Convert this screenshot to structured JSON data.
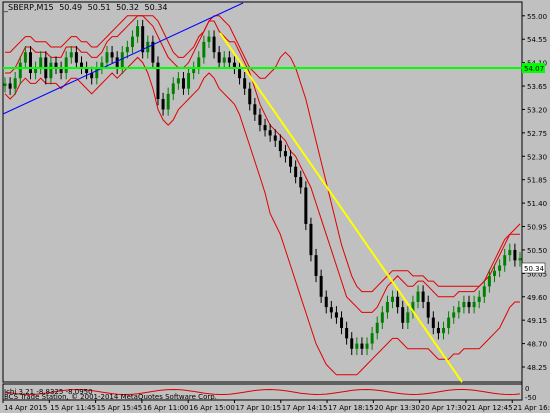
{
  "window": {
    "symbol": "_SBERP,M15",
    "ohlc": [
      "50.49",
      "50.51",
      "50.32",
      "50.34"
    ]
  },
  "indicator": {
    "label": "Ichi 3.21 -8.8325 -8.0950"
  },
  "copyright": "BCS Trade Station, © 2001-2014 MetaQuotes Software Corp.",
  "colors": {
    "background": "#c0c0c0",
    "bull": "#008000",
    "bear": "#000000",
    "bands": "#e00000",
    "trendline": "#ffff00",
    "channel": "#0000ff",
    "hline": "#00ff00"
  },
  "chart_data": {
    "type": "candlestick",
    "y_ticks": [
      "55.00",
      "54.55",
      "54.10",
      "53.65",
      "53.20",
      "52.75",
      "52.30",
      "51.85",
      "51.40",
      "50.95",
      "50.50",
      "50.05",
      "49.60",
      "49.15",
      "48.70",
      "48.25"
    ],
    "ylim": [
      48.0,
      55.15
    ],
    "x_ticks": [
      "14 Apr 2015",
      "15 Apr 11:45",
      "15 Apr 15:45",
      "16 Apr 11:00",
      "16 Apr 15:00",
      "17 Apr 10:15",
      "17 Apr 14:15",
      "17 Apr 18:15",
      "20 Apr 13:30",
      "20 Apr 17:30",
      "21 Apr 12:45",
      "21 Apr 16:45"
    ],
    "horizontal_line": {
      "value": 54.07,
      "label": "54.07"
    },
    "price_badge": {
      "value": 50.34,
      "label": "50.34"
    },
    "indicator_ticks": [
      "0",
      "-50"
    ],
    "closes": [
      53.7,
      53.6,
      53.8,
      54.1,
      54.3,
      53.9,
      54.0,
      54.2,
      53.8,
      54.1,
      54.0,
      53.9,
      54.2,
      54.3,
      54.1,
      54.0,
      53.9,
      53.8,
      54.0,
      54.1,
      54.3,
      54.2,
      54.0,
      54.3,
      54.4,
      54.6,
      54.8,
      54.3,
      54.5,
      54.1,
      53.4,
      53.2,
      53.5,
      53.7,
      53.8,
      53.6,
      53.9,
      54.0,
      54.2,
      54.5,
      54.6,
      54.3,
      54.1,
      54.2,
      54.1,
      54.0,
      53.8,
      53.6,
      53.3,
      53.1,
      52.9,
      52.8,
      52.7,
      52.6,
      52.4,
      52.3,
      52.1,
      51.9,
      51.7,
      51.0,
      50.4,
      50.0,
      49.6,
      49.4,
      49.3,
      49.2,
      49.0,
      48.8,
      48.6,
      48.7,
      48.6,
      48.7,
      48.9,
      49.1,
      49.3,
      49.5,
      49.6,
      49.4,
      49.1,
      49.3,
      49.5,
      49.7,
      49.5,
      49.2,
      49.0,
      48.9,
      49.0,
      49.2,
      49.3,
      49.4,
      49.5,
      49.4,
      49.5,
      49.6,
      49.8,
      50.0,
      50.1,
      50.2,
      50.4,
      50.5,
      50.3,
      50.34
    ],
    "upper_band": [
      53.9,
      53.9,
      54.0,
      54.2,
      54.4,
      54.4,
      54.3,
      54.3,
      54.3,
      54.2,
      54.2,
      54.2,
      54.4,
      54.4,
      54.4,
      54.3,
      54.3,
      54.2,
      54.2,
      54.3,
      54.5,
      54.6,
      54.6,
      54.7,
      54.8,
      54.9,
      55.0,
      55.0,
      54.9,
      54.8,
      54.6,
      54.4,
      54.2,
      54.1,
      54.0,
      54.0,
      54.1,
      54.3,
      54.5,
      54.7,
      54.9,
      54.9,
      54.7,
      54.6,
      54.5,
      54.5,
      54.3,
      54.1,
      53.9,
      53.6,
      53.3,
      53.1,
      52.9,
      52.8,
      52.7,
      52.6,
      52.4,
      52.3,
      52.1,
      51.9,
      51.7,
      51.4,
      51.1,
      50.8,
      50.5,
      50.2,
      49.9,
      49.6,
      49.5,
      49.4,
      49.3,
      49.3,
      49.3,
      49.4,
      49.6,
      49.8,
      49.9,
      50.0,
      49.9,
      49.8,
      49.8,
      49.9,
      49.9,
      49.8,
      49.7,
      49.6,
      49.6,
      49.6,
      49.6,
      49.7,
      49.7,
      49.7,
      49.7,
      49.8,
      49.9,
      50.1,
      50.3,
      50.5,
      50.7,
      50.8,
      50.8,
      50.8
    ],
    "lower_band": [
      53.5,
      53.4,
      53.5,
      53.7,
      53.8,
      53.7,
      53.7,
      53.8,
      53.7,
      53.7,
      53.7,
      53.6,
      53.7,
      53.8,
      53.8,
      53.7,
      53.6,
      53.5,
      53.6,
      53.7,
      53.8,
      53.9,
      53.8,
      53.9,
      54.0,
      54.1,
      54.2,
      54.1,
      53.9,
      53.6,
      53.2,
      53.0,
      52.9,
      53.0,
      53.2,
      53.3,
      53.4,
      53.5,
      53.6,
      53.8,
      53.9,
      53.8,
      53.6,
      53.5,
      53.4,
      53.3,
      53.1,
      52.8,
      52.5,
      52.2,
      51.9,
      51.6,
      51.2,
      51.0,
      50.8,
      50.5,
      50.2,
      49.9,
      49.6,
      49.3,
      49.0,
      48.7,
      48.5,
      48.3,
      48.2,
      48.1,
      48.1,
      48.1,
      48.1,
      48.1,
      48.2,
      48.3,
      48.4,
      48.5,
      48.6,
      48.7,
      48.8,
      48.8,
      48.7,
      48.6,
      48.6,
      48.6,
      48.6,
      48.6,
      48.5,
      48.4,
      48.4,
      48.4,
      48.5,
      48.5,
      48.6,
      48.6,
      48.6,
      48.6,
      48.7,
      48.8,
      48.9,
      49.0,
      49.2,
      49.4,
      49.5,
      49.5
    ],
    "outer_upper": [
      54.3,
      54.3,
      54.4,
      54.5,
      54.6,
      54.6,
      54.5,
      54.5,
      54.5,
      54.4,
      54.4,
      54.4,
      54.5,
      54.6,
      54.6,
      54.5,
      54.5,
      54.4,
      54.4,
      54.5,
      54.6,
      54.7,
      54.8,
      54.9,
      55.0,
      55.0,
      55.0,
      55.0,
      55.0,
      55.0,
      54.9,
      54.7,
      54.5,
      54.3,
      54.2,
      54.2,
      54.3,
      54.4,
      54.6,
      54.7,
      54.9,
      55.0,
      55.0,
      54.9,
      54.8,
      54.6,
      54.4,
      54.2,
      54.0,
      53.9,
      53.8,
      53.8,
      53.9,
      54.0,
      54.2,
      54.3,
      54.2,
      54.0,
      53.7,
      53.4,
      53.0,
      52.6,
      52.2,
      51.8,
      51.4,
      51.0,
      50.6,
      50.3,
      50.0,
      49.8,
      49.7,
      49.7,
      49.7,
      49.8,
      49.9,
      50.0,
      50.1,
      50.1,
      50.1,
      50.1,
      50.0,
      50.0,
      50.0,
      49.9,
      49.9,
      49.8,
      49.8,
      49.8,
      49.8,
      49.8,
      49.8,
      49.8,
      49.8,
      49.8,
      49.9,
      50.0,
      50.2,
      50.4,
      50.6,
      50.8,
      50.9,
      51.0
    ]
  }
}
